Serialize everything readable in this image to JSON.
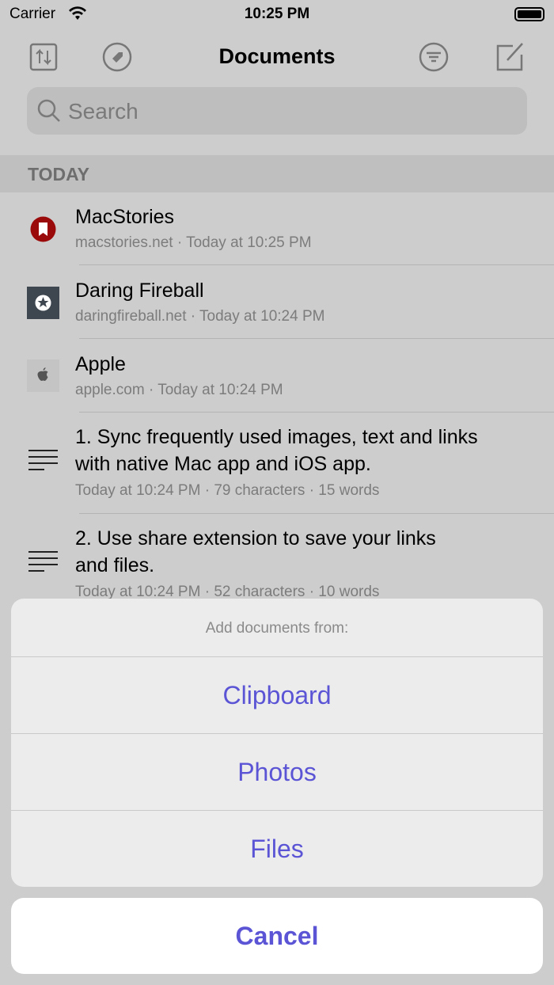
{
  "status": {
    "carrier": "Carrier",
    "time": "10:25 PM"
  },
  "nav": {
    "title": "Documents"
  },
  "search": {
    "placeholder": "Search"
  },
  "section": "TODAY",
  "items": [
    {
      "title": "MacStories",
      "subtitle": "macstories.net · Today at 10:25 PM"
    },
    {
      "title": "Daring Fireball",
      "subtitle": "daringfireball.net · Today at 10:24 PM"
    },
    {
      "title": "Apple",
      "subtitle": "apple.com · Today at 10:24 PM"
    },
    {
      "title_line1": "1. Sync frequently used images, text and links",
      "title_line2": "with native Mac app and iOS app.",
      "subtitle": "Today at 10:24 PM · 79 characters · 15 words"
    },
    {
      "title_line1": "2. Use share extension to save your links",
      "title_line2": "and files.",
      "subtitle": "Today at 10:24 PM · 52 characters · 10 words"
    }
  ],
  "sheet": {
    "header": "Add documents from:",
    "options": [
      "Clipboard",
      "Photos",
      "Files"
    ],
    "cancel": "Cancel"
  },
  "colors": {
    "accent": "#5b55d6",
    "macstories": "#9b0a0a",
    "daringfireball": "#3e4650"
  }
}
